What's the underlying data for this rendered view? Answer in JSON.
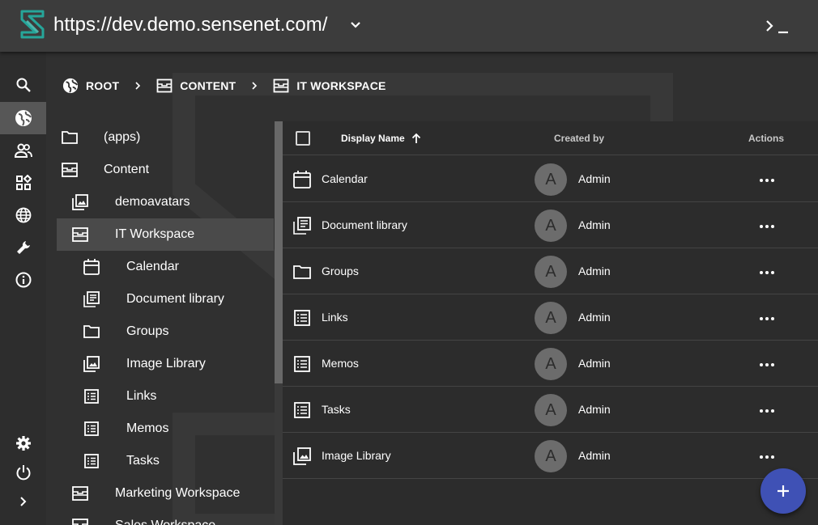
{
  "appbar": {
    "repository_url": "https://dev.demo.sensenet.com/",
    "logo_icon": "sensenet-logo",
    "dropdown_icon": "chevron-down-icon",
    "command_icon": "command-prompt-icon"
  },
  "rail": {
    "items": [
      {
        "icon": "search-icon"
      },
      {
        "icon": "globe-icon",
        "active": true
      },
      {
        "icon": "users-icon"
      },
      {
        "icon": "widgets-icon"
      },
      {
        "icon": "language-icon"
      },
      {
        "icon": "wrench-icon"
      },
      {
        "icon": "info-icon"
      }
    ],
    "bottom_items": [
      {
        "icon": "gear-icon"
      },
      {
        "icon": "power-icon"
      },
      {
        "icon": "chevron-right-icon"
      }
    ]
  },
  "breadcrumb": {
    "items": [
      "ROOT",
      "CONTENT",
      "IT WORKSPACE"
    ]
  },
  "tree": {
    "items": [
      {
        "label": "(apps)",
        "icon": "folder-icon",
        "level": 0
      },
      {
        "label": "Content",
        "icon": "workspace-icon",
        "level": 0
      },
      {
        "label": "demoavatars",
        "icon": "image-library-icon",
        "level": 1
      },
      {
        "label": "IT Workspace",
        "icon": "workspace-icon",
        "level": 1,
        "selected": true
      },
      {
        "label": "Calendar",
        "icon": "calendar-icon",
        "level": 2
      },
      {
        "label": "Document library",
        "icon": "document-library-icon",
        "level": 2
      },
      {
        "label": "Groups",
        "icon": "folder-icon",
        "level": 2
      },
      {
        "label": "Image Library",
        "icon": "image-library-icon",
        "level": 2
      },
      {
        "label": "Links",
        "icon": "list-icon",
        "level": 2
      },
      {
        "label": "Memos",
        "icon": "list-icon",
        "level": 2
      },
      {
        "label": "Tasks",
        "icon": "list-icon",
        "level": 2
      },
      {
        "label": "Marketing Workspace",
        "icon": "workspace-icon",
        "level": 1
      },
      {
        "label": "Sales Workspace",
        "icon": "workspace-icon",
        "level": 1
      }
    ]
  },
  "table": {
    "columns": {
      "display_name": "Display Name",
      "created_by": "Created by",
      "actions": "Actions"
    },
    "sort_icon": "arrow-up-icon",
    "rows": [
      {
        "name": "Calendar",
        "icon": "calendar-icon",
        "avatar": "A",
        "created_by": "Admin"
      },
      {
        "name": "Document library",
        "icon": "document-library-icon",
        "avatar": "A",
        "created_by": "Admin"
      },
      {
        "name": "Groups",
        "icon": "folder-icon",
        "avatar": "A",
        "created_by": "Admin"
      },
      {
        "name": "Links",
        "icon": "list-icon",
        "avatar": "A",
        "created_by": "Admin"
      },
      {
        "name": "Memos",
        "icon": "list-icon",
        "avatar": "A",
        "created_by": "Admin"
      },
      {
        "name": "Tasks",
        "icon": "list-icon",
        "avatar": "A",
        "created_by": "Admin"
      },
      {
        "name": "Image Library",
        "icon": "image-library-icon",
        "avatar": "A",
        "created_by": "Admin"
      }
    ]
  },
  "fab": {
    "icon": "add-icon"
  },
  "colors": {
    "appbar": "#3c3c3c",
    "rail": "#2d2d2d",
    "active_rail": "#575757",
    "selected_tree": "#4a4a4a",
    "fab": "#3f51b5",
    "avatar": "#6c6c6c",
    "logo_teal": "#26a69a"
  }
}
